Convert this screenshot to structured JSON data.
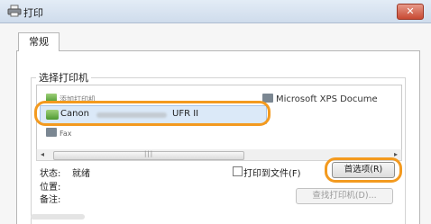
{
  "window": {
    "title": "打印",
    "close_label": "✕"
  },
  "tab": {
    "label": "常规"
  },
  "group": {
    "title": "选择打印机"
  },
  "printers": {
    "add_label": "添加打印机",
    "xps_label": "Microsoft XPS Docume",
    "selected_brand": "Canon",
    "selected_model": "UFR II",
    "fax_label": "Fax"
  },
  "status": {
    "status_label": "状态:",
    "status_value": "就绪",
    "location_label": "位置:",
    "comment_label": "备注:"
  },
  "options": {
    "print_to_file_label": "打印到文件(F)",
    "print_to_file_checked": false,
    "preferences_label": "首选项(R)",
    "find_printer_label": "查找打印机(D)..."
  },
  "scrollbar": {
    "left_arrow": "◂",
    "right_arrow": "▸",
    "grip": "|||"
  },
  "colors": {
    "highlight": "#f39a1f",
    "selection": "#dbe9f8"
  }
}
